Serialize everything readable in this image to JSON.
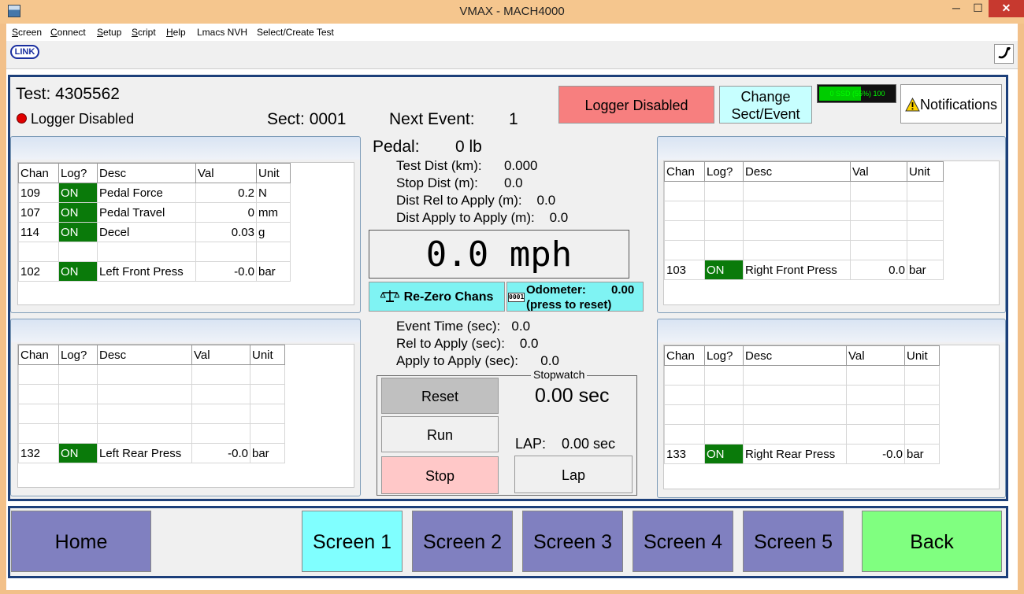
{
  "window": {
    "title": "VMAX - MACH4000",
    "controls": {
      "minimize": "─",
      "maximize": "☐",
      "close": "✕"
    }
  },
  "menu": [
    {
      "u": "S",
      "rest": "creen"
    },
    {
      "u": "C",
      "rest": "onnect"
    },
    {
      "u": "S",
      "rest": "etup"
    },
    {
      "u": "S",
      "rest": "cript"
    },
    {
      "u": "H",
      "rest": "elp"
    },
    {
      "u": "",
      "rest": "Lmacs NVH"
    },
    {
      "u": "",
      "rest": "Select/Create Test"
    }
  ],
  "toolbar": {
    "link_label": "LINK",
    "wrench_icon": "wrench-icon"
  },
  "header": {
    "test_label": "Test: 4305562",
    "logger_status": "Logger Disabled",
    "status_color": "#e00000",
    "sect": "Sect: 0001",
    "next_event_label": "Next Event:",
    "next_event_value": "1",
    "logger_button": "Logger Disabled",
    "change_button_line1": "Change",
    "change_button_line2": "Sect/Event",
    "ssd": {
      "text": "0     SSD (55%)  100",
      "percent": 55
    },
    "notifications_button": "Notifications"
  },
  "panels": {
    "top_left": {
      "columns": [
        "Chan",
        "Log?",
        "Desc",
        "Val",
        "Unit"
      ],
      "rows": [
        {
          "chan": "109",
          "log": "ON",
          "desc": "Pedal Force",
          "val": "0.2",
          "unit": "N"
        },
        {
          "chan": "107",
          "log": "ON",
          "desc": "Pedal Travel",
          "val": "0",
          "unit": "mm"
        },
        {
          "chan": "114",
          "log": "ON",
          "desc": "Decel",
          "val": "0.03",
          "unit": "g"
        },
        {
          "chan": "",
          "log": "",
          "desc": "",
          "val": "",
          "unit": ""
        },
        {
          "chan": "102",
          "log": "ON",
          "desc": "Left Front Press",
          "val": "-0.0",
          "unit": "bar"
        }
      ]
    },
    "bottom_left": {
      "columns": [
        "Chan",
        "Log?",
        "Desc",
        "Val",
        "Unit"
      ],
      "rows": [
        {
          "chan": "",
          "log": "",
          "desc": "",
          "val": "",
          "unit": ""
        },
        {
          "chan": "",
          "log": "",
          "desc": "",
          "val": "",
          "unit": ""
        },
        {
          "chan": "",
          "log": "",
          "desc": "",
          "val": "",
          "unit": ""
        },
        {
          "chan": "",
          "log": "",
          "desc": "",
          "val": "",
          "unit": ""
        },
        {
          "chan": "132",
          "log": "ON",
          "desc": "Left Rear Press",
          "val": "-0.0",
          "unit": "bar"
        }
      ]
    },
    "top_right": {
      "columns": [
        "Chan",
        "Log?",
        "Desc",
        "Val",
        "Unit"
      ],
      "rows": [
        {
          "chan": "",
          "log": "",
          "desc": "",
          "val": "",
          "unit": ""
        },
        {
          "chan": "",
          "log": "",
          "desc": "",
          "val": "",
          "unit": ""
        },
        {
          "chan": "",
          "log": "",
          "desc": "",
          "val": "",
          "unit": ""
        },
        {
          "chan": "",
          "log": "",
          "desc": "",
          "val": "",
          "unit": ""
        },
        {
          "chan": "103",
          "log": "ON",
          "desc": "Right Front Press",
          "val": "0.0",
          "unit": "bar"
        }
      ]
    },
    "bottom_right": {
      "columns": [
        "Chan",
        "Log?",
        "Desc",
        "Val",
        "Unit"
      ],
      "rows": [
        {
          "chan": "",
          "log": "",
          "desc": "",
          "val": "",
          "unit": ""
        },
        {
          "chan": "",
          "log": "",
          "desc": "",
          "val": "",
          "unit": ""
        },
        {
          "chan": "",
          "log": "",
          "desc": "",
          "val": "",
          "unit": ""
        },
        {
          "chan": "",
          "log": "",
          "desc": "",
          "val": "",
          "unit": ""
        },
        {
          "chan": "133",
          "log": "ON",
          "desc": "Right Rear Press",
          "val": "-0.0",
          "unit": "bar"
        }
      ]
    }
  },
  "center": {
    "pedal_label": "Pedal:",
    "pedal_value": "0 lb",
    "test_dist": "Test Dist (km):      0.000",
    "stop_dist": "Stop Dist (m):       0.0",
    "dist_rel": "Dist Rel to Apply (m):    0.0",
    "dist_apply": "Dist Apply to Apply (m):    0.0",
    "speed": "0.0 mph",
    "rezero_button": "Re-Zero Chans",
    "odometer_label": "Odometer:",
    "odometer_value": "0.00",
    "odometer_reset": "(press to reset)",
    "odometer_icon_text": "0001",
    "event_time": "Event Time (sec):   0.0",
    "rel_apply": "Rel to Apply (sec):    0.0",
    "apply_apply": "Apply to Apply (sec):      0.0"
  },
  "stopwatch": {
    "title": "Stopwatch",
    "time": "0.00 sec",
    "lap_label": "LAP:",
    "lap_value": "0.00 sec",
    "reset": "Reset",
    "run": "Run",
    "stop": "Stop",
    "lap": "Lap"
  },
  "nav": {
    "home": "Home",
    "screen1": "Screen 1",
    "screen2": "Screen 2",
    "screen3": "Screen 3",
    "screen4": "Screen 4",
    "screen5": "Screen 5",
    "back": "Back"
  }
}
